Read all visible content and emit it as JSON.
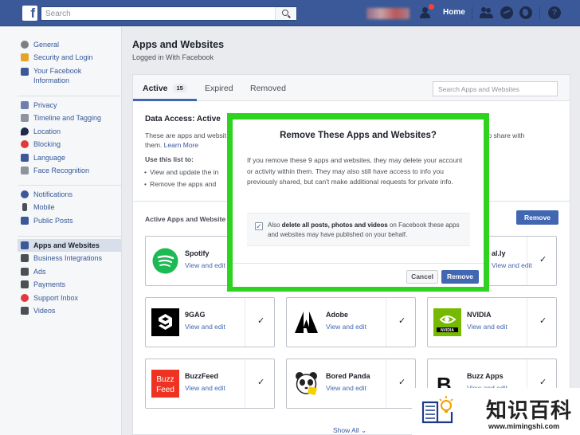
{
  "topbar": {
    "search_placeholder": "Search",
    "home": "Home",
    "help_glyph": "?"
  },
  "sidebar": {
    "groups": [
      [
        {
          "label": "General",
          "icon": "gear-icon",
          "color": "#7f7f7f"
        },
        {
          "label": "Security and Login",
          "icon": "shield-icon",
          "color": "#e4a428"
        },
        {
          "label": "Your Facebook Information",
          "icon": "facebook-icon",
          "color": "#3b5998"
        }
      ],
      [
        {
          "label": "Privacy",
          "icon": "lock-icon",
          "color": "#6e7fb0"
        },
        {
          "label": "Timeline and Tagging",
          "icon": "timeline-icon",
          "color": "#8d949e"
        },
        {
          "label": "Location",
          "icon": "location-icon",
          "color": "#1d2c4c"
        },
        {
          "label": "Blocking",
          "icon": "blocking-icon",
          "color": "#e0393e"
        },
        {
          "label": "Language",
          "icon": "language-icon",
          "color": "#3b5998"
        },
        {
          "label": "Face Recognition",
          "icon": "face-recognition-icon",
          "color": "#8d949e"
        }
      ],
      [
        {
          "label": "Notifications",
          "icon": "globe-icon",
          "color": "#3b5998"
        },
        {
          "label": "Mobile",
          "icon": "mobile-icon",
          "color": "#4b4f56"
        },
        {
          "label": "Public Posts",
          "icon": "public-posts-icon",
          "color": "#3b5998"
        }
      ],
      [
        {
          "label": "Apps and Websites",
          "icon": "apps-icon",
          "color": "#3b5998"
        },
        {
          "label": "Business Integrations",
          "icon": "business-icon",
          "color": "#4b4f56"
        },
        {
          "label": "Ads",
          "icon": "ads-icon",
          "color": "#4b4f56"
        },
        {
          "label": "Payments",
          "icon": "payments-icon",
          "color": "#4b4f56"
        },
        {
          "label": "Support Inbox",
          "icon": "support-inbox-icon",
          "color": "#e0393e"
        },
        {
          "label": "Videos",
          "icon": "videos-icon",
          "color": "#4b4f56"
        }
      ]
    ]
  },
  "main": {
    "title": "Apps and Websites",
    "subtitle": "Logged in With Facebook",
    "tabs": [
      {
        "label": "Active",
        "badge": "15"
      },
      {
        "label": "Expired"
      },
      {
        "label": "Removed"
      }
    ],
    "search_placeholder": "Search Apps and Websites",
    "access_title": "Data Access: Active",
    "access_line1_left": "These are apps and websit",
    "access_line1_right": "you chose to share with",
    "access_line2_text": "them.",
    "learn_more": "Learn More",
    "use_this_list": "Use this list to:",
    "bullet1": "View and update the in",
    "bullet2": "Remove the apps and",
    "active_apps_label": "Active Apps and Website",
    "remove_button": "Remove",
    "view_and_edit": "View and edit",
    "show_all": "Show All",
    "apps": [
      {
        "name": "Spotify",
        "logo": "spotify-logo"
      },
      {
        "name": "al.ly",
        "logo": "hidden-logo"
      },
      {
        "name": "9GAG",
        "logo": "9gag-logo"
      },
      {
        "name": "Adobe",
        "logo": "adobe-logo"
      },
      {
        "name": "NVIDIA",
        "logo": "nvidia-logo"
      },
      {
        "name": "BuzzFeed",
        "logo": "buzzfeed-logo"
      },
      {
        "name": "Bored Panda",
        "logo": "bored-panda-logo"
      },
      {
        "name": "Buzz Apps",
        "logo": "buzz-apps-logo"
      }
    ],
    "check_glyph": "✓"
  },
  "modal": {
    "title": "Remove These Apps and Websites?",
    "body": "If you remove these 9 apps and websites, they may delete your account or activity within them. They may also still have access to info you previously shared, but can't make additional requests for private info.",
    "checkbox_prefix": "Also",
    "checkbox_bold": "delete all posts, photos and videos",
    "checkbox_suffix": "on Facebook these apps and websites may have published on your behalf.",
    "checkbox_checked": true,
    "cancel": "Cancel",
    "remove": "Remove",
    "highlight_color": "#2ed31f"
  },
  "watermark": {
    "chinese": "知识百科",
    "url": "www.mimingshi.com"
  },
  "colors": {
    "facebook_blue": "#3b5998",
    "button_blue": "#4267b2",
    "link_blue": "#365899"
  }
}
